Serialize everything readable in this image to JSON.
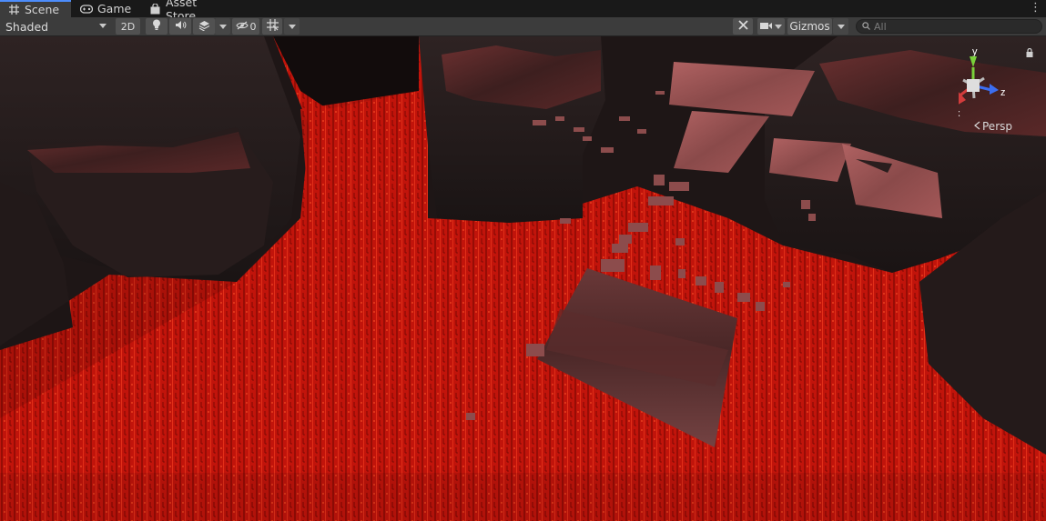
{
  "tabs": [
    {
      "label": "Scene",
      "icon": "hash-grid-icon",
      "active": true
    },
    {
      "label": "Game",
      "icon": "gamepad-icon",
      "active": false
    },
    {
      "label": "Asset Store",
      "icon": "shopping-bag-icon",
      "active": false
    }
  ],
  "toolbar": {
    "draw_mode": "Shaded",
    "mode_2d": "2D",
    "hidden_count": "0",
    "gizmos_label": "Gizmos",
    "search_placeholder": "All"
  },
  "gizmo": {
    "y_label": "y",
    "x_label": "x",
    "z_label": "z",
    "projection_label": "Persp"
  },
  "colors": {
    "accent": "#4d8dfc",
    "lava": "#c8140c",
    "axis_x": "#d23c3c",
    "axis_y": "#7ad13a",
    "axis_z": "#3c6ef0"
  }
}
